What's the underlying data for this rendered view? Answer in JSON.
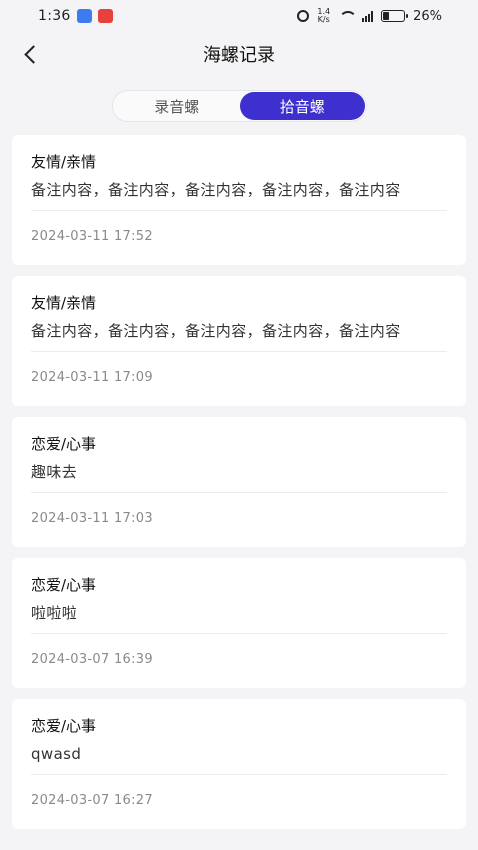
{
  "status_bar": {
    "time": "1:36",
    "speed_top": "1.4",
    "speed_bottom": "K/s",
    "signal_label": "46",
    "battery": "26%"
  },
  "header": {
    "title": "海螺记录"
  },
  "tabs": [
    {
      "label": "录音螺",
      "active": false
    },
    {
      "label": "拾音螺",
      "active": true
    }
  ],
  "records": [
    {
      "category": "友情/亲情",
      "note": "备注内容，备注内容，备注内容，备注内容，备注内容",
      "date": "2024-03-11 17:52"
    },
    {
      "category": "友情/亲情",
      "note": "备注内容，备注内容，备注内容，备注内容，备注内容",
      "date": "2024-03-11 17:09"
    },
    {
      "category": "恋爱/心事",
      "note": "趣味去",
      "date": "2024-03-11 17:03"
    },
    {
      "category": "恋爱/心事",
      "note": "啦啦啦",
      "date": "2024-03-07 16:39"
    },
    {
      "category": "恋爱/心事",
      "note": "qwasd",
      "date": "2024-03-07 16:27"
    }
  ],
  "colors": {
    "accent": "#3e2fcf",
    "background": "#f4f4f6"
  }
}
